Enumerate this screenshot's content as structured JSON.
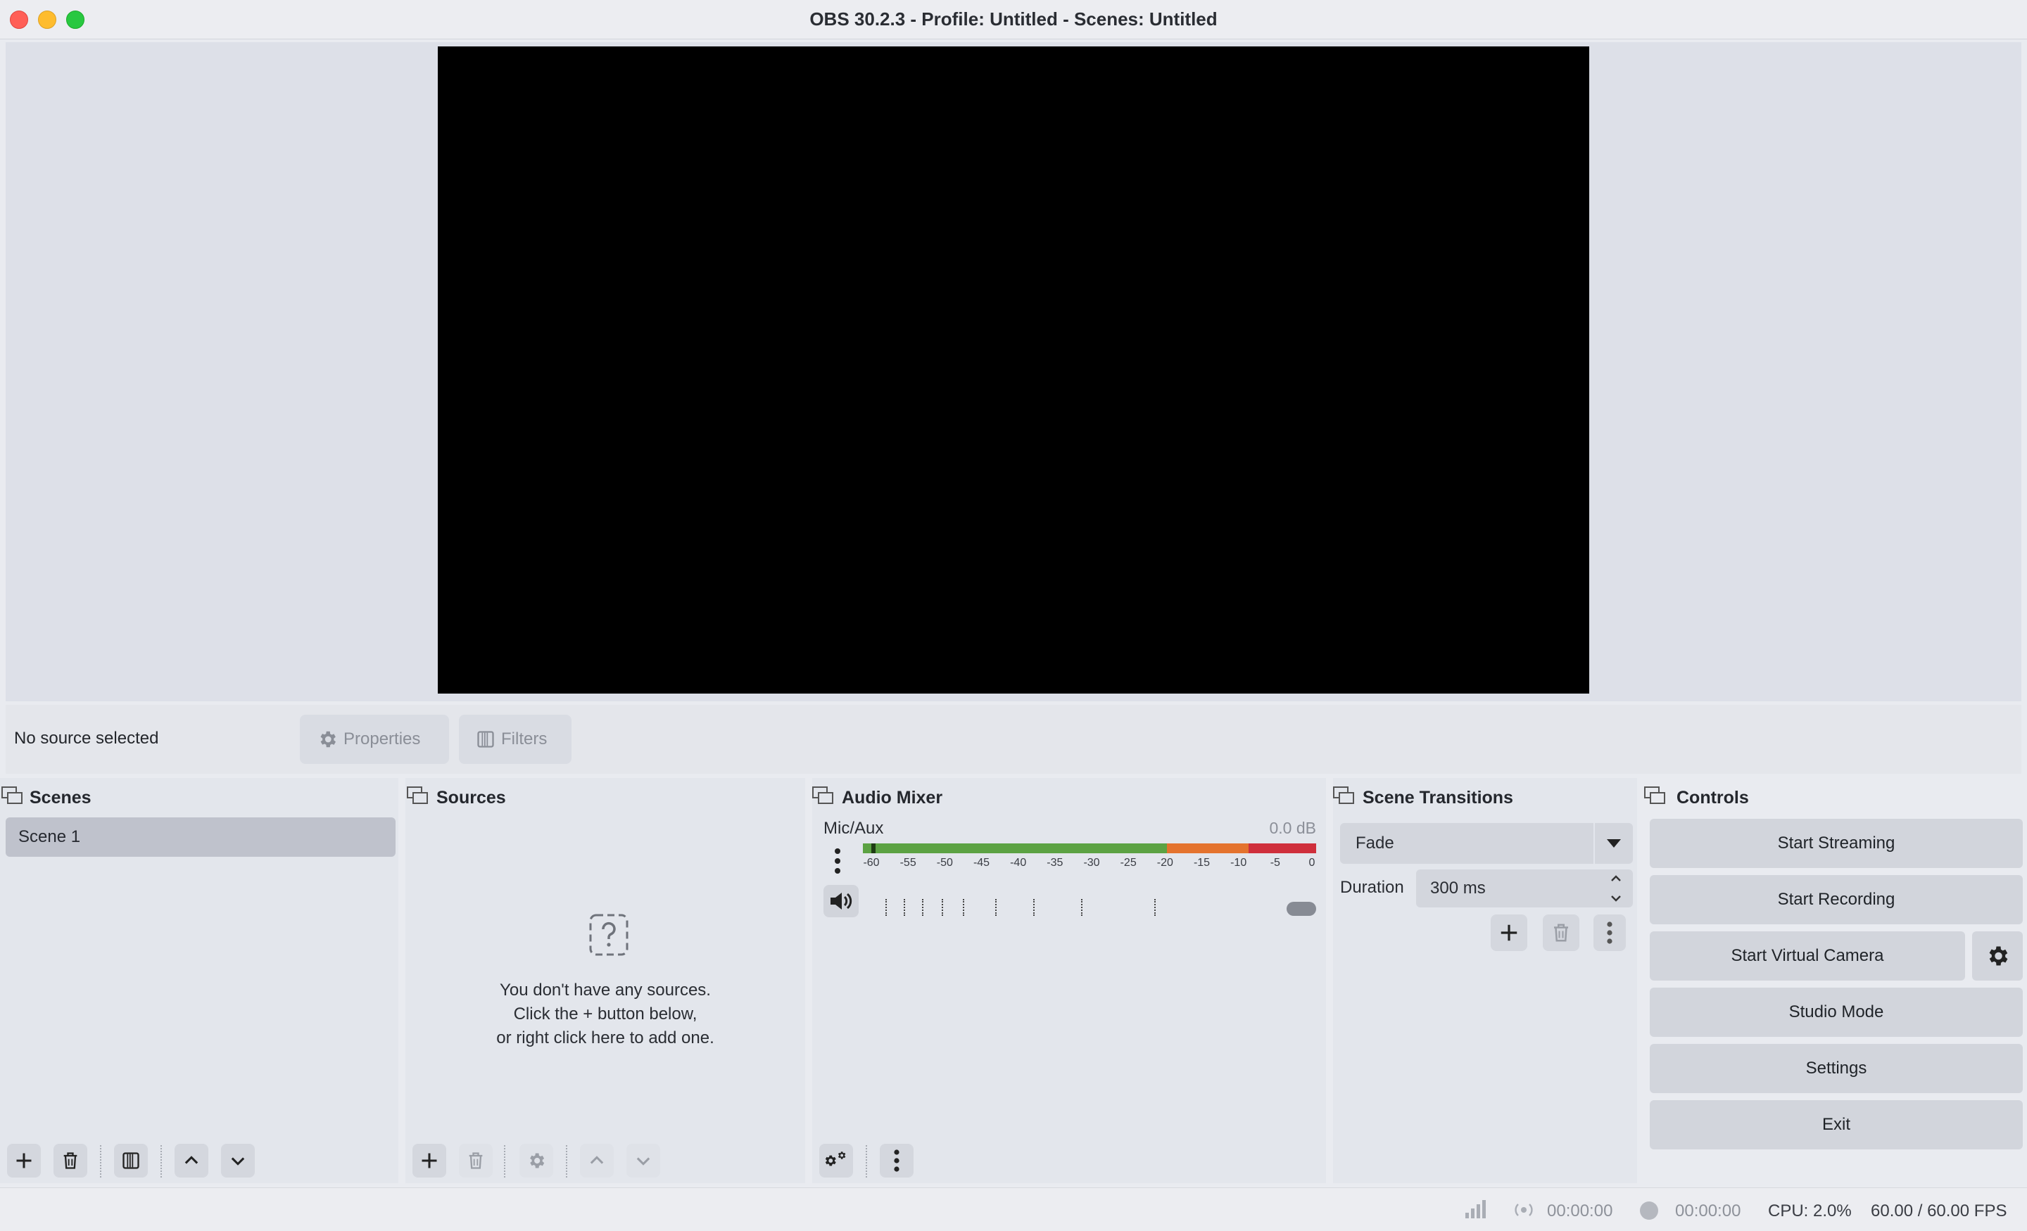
{
  "window": {
    "title": "OBS 30.2.3 - Profile: Untitled - Scenes: Untitled"
  },
  "context_bar": {
    "no_source_text": "No source selected",
    "properties_label": "Properties",
    "filters_label": "Filters"
  },
  "docks": {
    "scenes": {
      "title": "Scenes",
      "items": [
        "Scene 1"
      ]
    },
    "sources": {
      "title": "Sources",
      "empty_line1": "You don't have any sources.",
      "empty_line2": "Click the + button below,",
      "empty_line3": "or right click here to add one."
    },
    "mixer": {
      "title": "Audio Mixer",
      "channel_name": "Mic/Aux",
      "channel_db": "0.0 dB",
      "meter_ticks": [
        "-60",
        "-55",
        "-50",
        "-45",
        "-40",
        "-35",
        "-30",
        "-25",
        "-20",
        "-15",
        "-10",
        "-5",
        "0"
      ],
      "meter_colors": {
        "green": "#5ca243",
        "orange": "#e4732e",
        "red": "#cf2f3c"
      },
      "volume_level": 1.0
    },
    "transitions": {
      "title": "Scene Transitions",
      "selected": "Fade",
      "duration_label": "Duration",
      "duration_value": "300 ms"
    },
    "controls": {
      "title": "Controls",
      "start_streaming": "Start Streaming",
      "start_recording": "Start Recording",
      "start_virtual_camera": "Start Virtual Camera",
      "studio_mode": "Studio Mode",
      "settings": "Settings",
      "exit": "Exit"
    }
  },
  "status_bar": {
    "stream_time": "00:00:00",
    "record_time": "00:00:00",
    "cpu": "CPU: 2.0%",
    "fps": "60.00 / 60.00 FPS"
  }
}
